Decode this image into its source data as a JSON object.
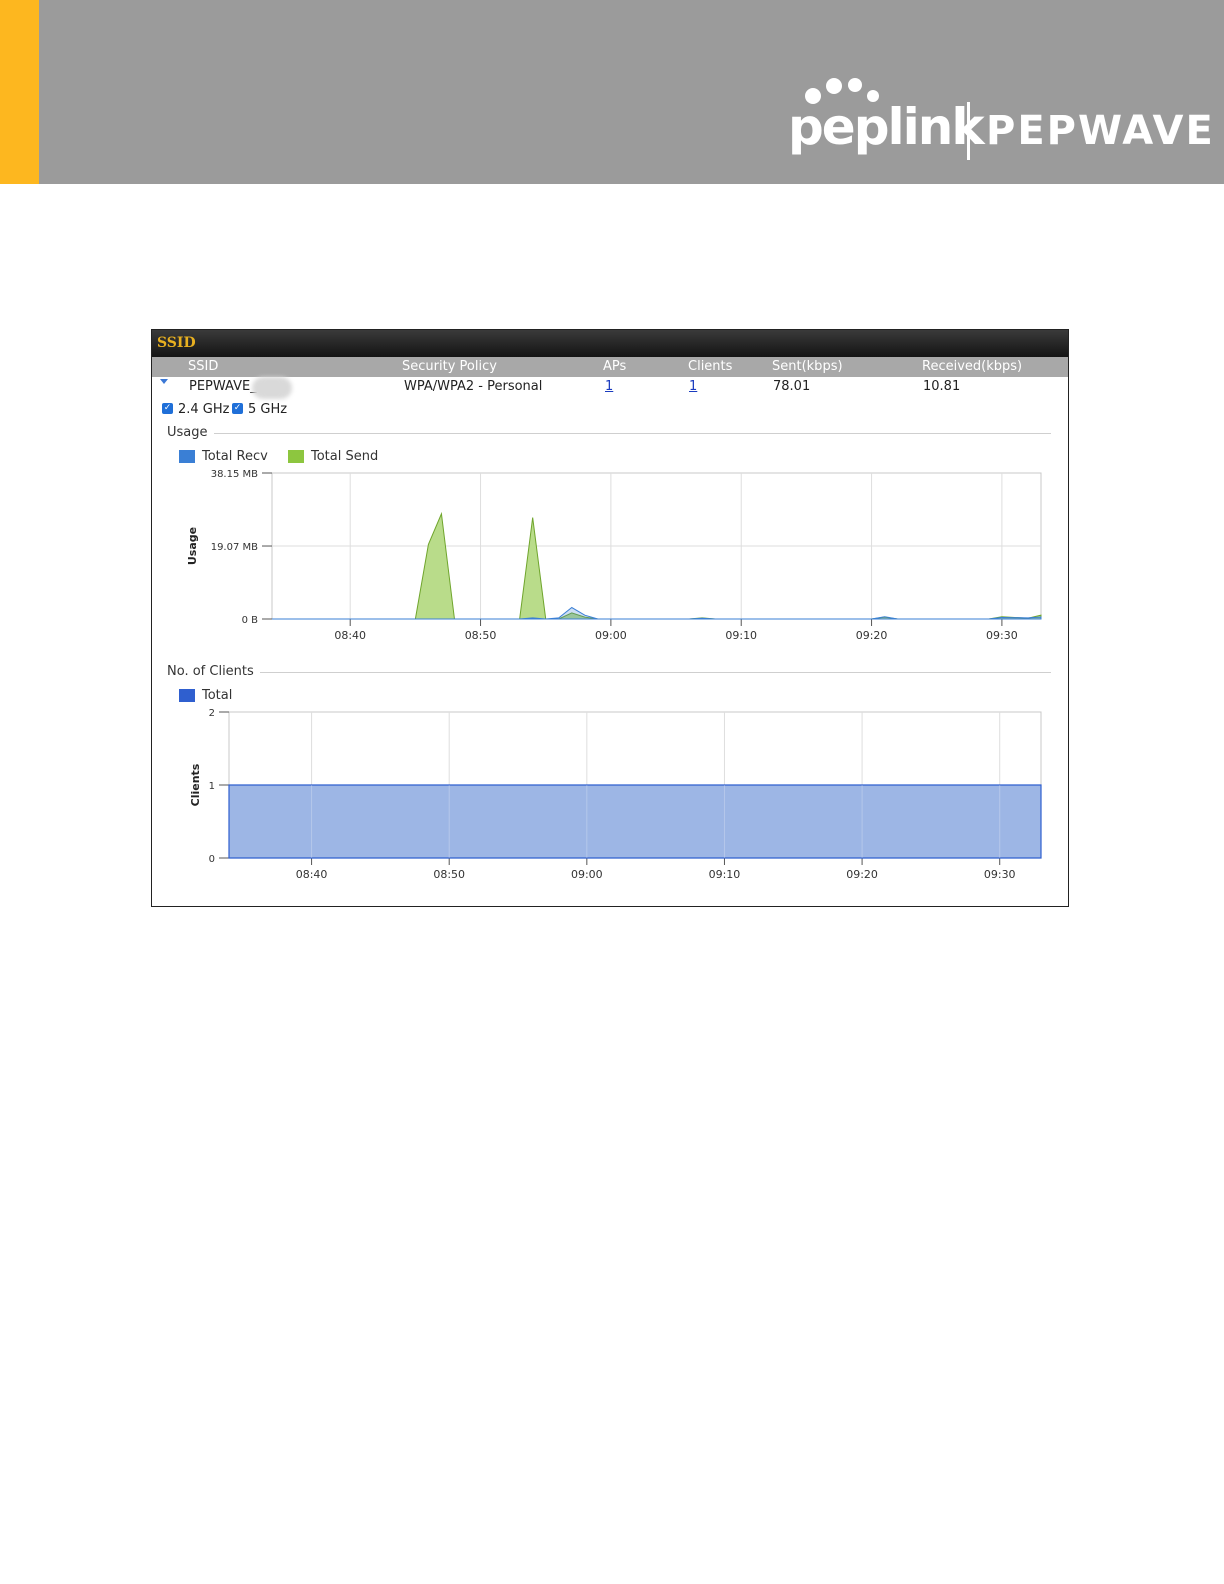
{
  "header": {
    "brand_left": "peplink",
    "brand_right": "PEPWAVE",
    "colors": {
      "band": "#9b9b9b",
      "accent": "#fdb71f"
    }
  },
  "panel": {
    "title": "SSID",
    "columns": [
      "SSID",
      "Security Policy",
      "APs",
      "Clients",
      "Sent(kbps)",
      "Received(kbps)"
    ],
    "row": {
      "ssid": "PEPWAVE_",
      "security_policy": "WPA/WPA2 - Personal",
      "aps": "1",
      "clients": "1",
      "sent": "78.01",
      "received": "10.81"
    },
    "bands": [
      {
        "label": "2.4 GHz",
        "checked": true
      },
      {
        "label": "5 GHz",
        "checked": true
      }
    ]
  },
  "usage": {
    "section_title": "Usage"
  },
  "clients_section": {
    "section_title": "No. of Clients"
  },
  "chart_data": [
    {
      "type": "area",
      "ylabel": "Usage",
      "y_ticks": [
        "38.15 MB",
        "19.07 MB",
        "0 B"
      ],
      "ylim_mb": [
        0,
        38.15
      ],
      "x_ticks": [
        "08:40",
        "08:50",
        "09:00",
        "09:10",
        "09:20",
        "09:30"
      ],
      "xlim": [
        "08:34",
        "09:33"
      ],
      "grid": true,
      "legend": "top-left",
      "series": [
        {
          "name": "Total Recv",
          "color": "#3a7fd5",
          "x": [
            "08:34",
            "08:45",
            "08:46",
            "08:47",
            "08:48",
            "08:49",
            "08:50",
            "08:53",
            "08:54",
            "08:55",
            "08:56",
            "08:57",
            "08:58",
            "08:59",
            "09:00",
            "09:06",
            "09:07",
            "09:08",
            "09:20",
            "09:21",
            "09:22",
            "09:29",
            "09:30",
            "09:32",
            "09:33"
          ],
          "values_mb": [
            0,
            0,
            0,
            0,
            0,
            0,
            0,
            0,
            0.3,
            0,
            0.3,
            3.0,
            1.0,
            0,
            0,
            0,
            0.2,
            0,
            0,
            0.6,
            0,
            0,
            0.4,
            0.3,
            0.5
          ]
        },
        {
          "name": "Total Send",
          "color": "#8dc63f",
          "x": [
            "08:34",
            "08:45",
            "08:46",
            "08:47",
            "08:48",
            "08:49",
            "08:50",
            "08:53",
            "08:54",
            "08:55",
            "08:56",
            "08:57",
            "08:58",
            "08:59",
            "09:00",
            "09:06",
            "09:07",
            "09:08",
            "09:20",
            "09:21",
            "09:22",
            "09:29",
            "09:30",
            "09:32",
            "09:33"
          ],
          "values_mb": [
            0,
            0,
            19.5,
            27.5,
            0,
            0,
            0,
            0,
            26.5,
            0,
            0,
            1.6,
            0.5,
            0,
            0,
            0,
            0.3,
            0,
            0,
            0.5,
            0,
            0,
            0.6,
            0.2,
            1.0
          ]
        }
      ]
    },
    {
      "type": "area",
      "ylabel": "Clients",
      "y_ticks": [
        "2",
        "1",
        "0"
      ],
      "ylim": [
        0,
        2
      ],
      "x_ticks": [
        "08:40",
        "08:50",
        "09:00",
        "09:10",
        "09:20",
        "09:30"
      ],
      "xlim": [
        "08:34",
        "09:33"
      ],
      "grid": true,
      "legend": "top-left",
      "series": [
        {
          "name": "Total",
          "color": "#2f5fcf",
          "fill": "#98b2e4",
          "x": [
            "08:34",
            "09:33"
          ],
          "values": [
            1,
            1
          ]
        }
      ]
    }
  ]
}
